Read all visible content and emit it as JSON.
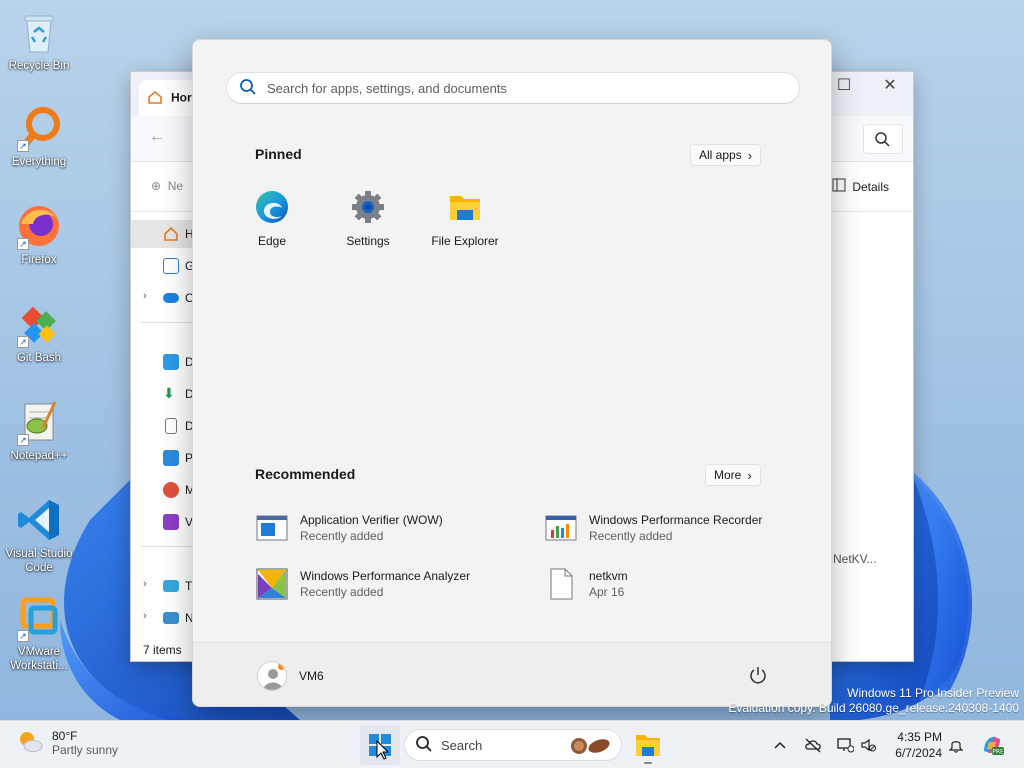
{
  "desktop": {
    "icons": [
      {
        "label": "Recycle Bin",
        "icon": "recycle-bin-icon"
      },
      {
        "label": "Everything",
        "icon": "everything-search-icon"
      },
      {
        "label": "Firefox",
        "icon": "firefox-icon"
      },
      {
        "label": "Git Bash",
        "icon": "git-bash-icon"
      },
      {
        "label": "Notepad++",
        "icon": "notepad-plus-plus-icon"
      },
      {
        "label": "Visual Studio Code",
        "icon": "vscode-icon"
      },
      {
        "label": "VMware Workstati...",
        "icon": "vmware-icon"
      }
    ]
  },
  "explorer": {
    "tab_label": "Hor",
    "new_label": "Ne",
    "details_label": "Details",
    "nav_items": [
      {
        "label": "H",
        "icon": "home-icon"
      },
      {
        "label": "G",
        "icon": "gallery-icon"
      },
      {
        "label": "O",
        "icon": "onedrive-icon"
      },
      {
        "label": "D",
        "icon": "desktop-folder-icon"
      },
      {
        "label": "D",
        "icon": "downloads-icon"
      },
      {
        "label": "D",
        "icon": "documents-icon"
      },
      {
        "label": "P",
        "icon": "pictures-icon"
      },
      {
        "label": "M",
        "icon": "music-icon"
      },
      {
        "label": "V",
        "icon": "videos-icon"
      },
      {
        "label": "T",
        "icon": "this-pc-icon"
      },
      {
        "label": "N",
        "icon": "network-icon"
      }
    ],
    "status": "7 items",
    "file_label": "NetKV..."
  },
  "start_menu": {
    "search_placeholder": "Search for apps, settings, and documents",
    "pinned_title": "Pinned",
    "all_apps_label": "All apps",
    "pinned": [
      {
        "label": "Edge",
        "icon": "edge-icon"
      },
      {
        "label": "Settings",
        "icon": "settings-gear-icon"
      },
      {
        "label": "File Explorer",
        "icon": "file-explorer-icon"
      }
    ],
    "recommended_title": "Recommended",
    "more_label": "More",
    "recommended": [
      {
        "name": "Application Verifier (WOW)",
        "sub": "Recently added",
        "icon": "app-verifier-icon"
      },
      {
        "name": "Windows Performance Recorder",
        "sub": "Recently added",
        "icon": "perf-recorder-icon"
      },
      {
        "name": "Windows Performance Analyzer",
        "sub": "Recently added",
        "icon": "perf-analyzer-icon"
      },
      {
        "name": "netkvm",
        "sub": "Apr 16",
        "icon": "file-icon"
      }
    ],
    "user_name": "VM6"
  },
  "watermark": {
    "line1": "Windows 11 Pro Insider Preview",
    "line2": "Evaluation copy. Build 26080.ge_release.240308-1400"
  },
  "taskbar": {
    "weather_temp": "80°F",
    "weather_desc": "Partly sunny",
    "search_label": "Search",
    "time": "4:35 PM",
    "date": "6/7/2024"
  }
}
